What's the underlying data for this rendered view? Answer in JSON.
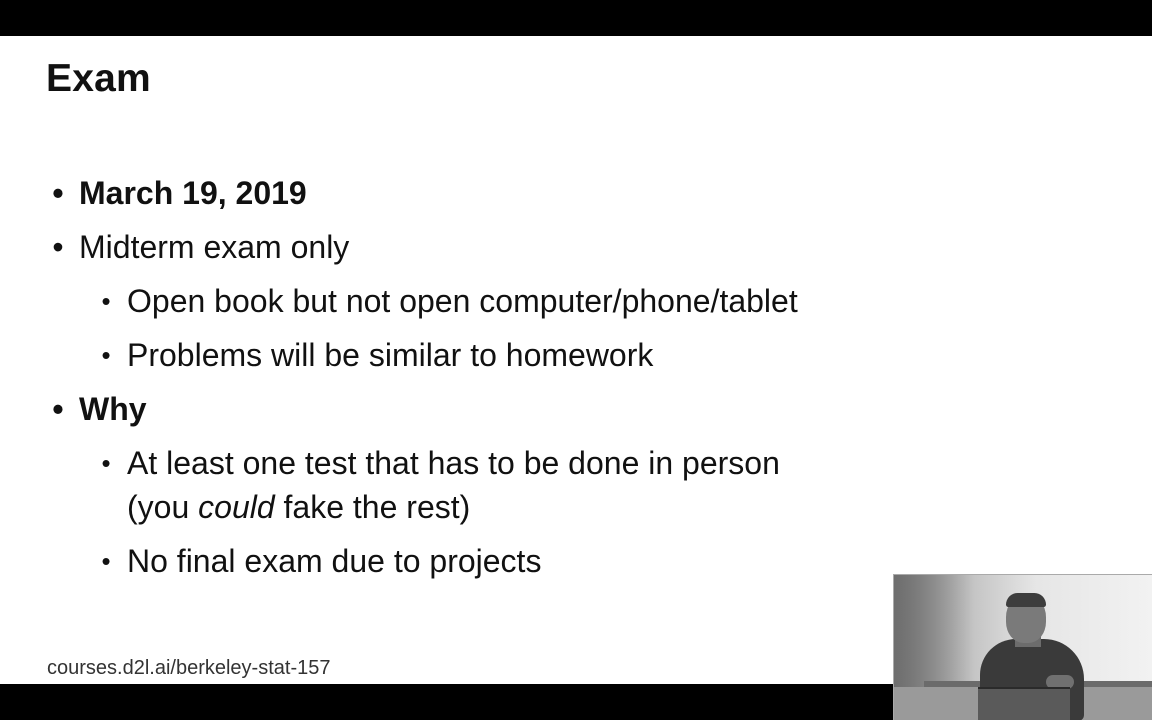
{
  "slide": {
    "title": "Exam",
    "bullets": [
      {
        "text": "March 19, 2019"
      },
      {
        "text": "Midterm exam only"
      },
      {
        "text": "Open book but not open computer/phone/tablet"
      },
      {
        "text": "Problems will be similar to homework"
      },
      {
        "text": "Why"
      },
      {
        "line1": "At least one test that has to be done in person",
        "line2_prefix": "(you ",
        "line2_em": "could",
        "line2_suffix": " fake the rest)"
      },
      {
        "text": "No final exam due to projects"
      }
    ],
    "footer": "courses.d2l.ai/berkeley-stat-157"
  },
  "colors": {
    "background": "#ffffff",
    "text": "#111111",
    "letterbox": "#000000"
  }
}
